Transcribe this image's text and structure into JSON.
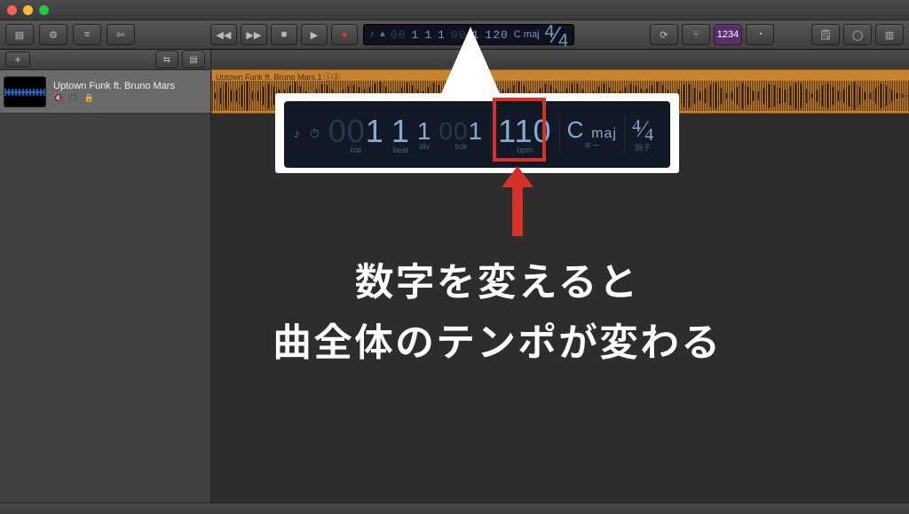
{
  "lcd_small": {
    "bar_dim": "00",
    "bar": "1",
    "beat": "1",
    "div": "1",
    "tick_dim": "00",
    "tick": "1",
    "tempo": "120",
    "key": "C maj",
    "timesig_num": "4",
    "timesig_den": "4"
  },
  "track": {
    "name": "Uptown Funk ft. Bruno Mars",
    "region_title": "Uptown Funk ft. Bruno Mars.1  ⓘ②"
  },
  "lcd_big": {
    "bar_dim": "00",
    "bar": "1",
    "beat": "1",
    "div": "1",
    "tick_dim": "00",
    "tick": "1",
    "tempo": "110",
    "key": "C",
    "key_mode": "maj",
    "timesig_num": "4",
    "timesig_den": "4",
    "label_bar": "bar",
    "label_beat": "beat",
    "label_div": "div",
    "label_tick": "tick",
    "label_bpm": "bpm",
    "label_key": "キー",
    "label_sig": "拍子"
  },
  "annotation": {
    "line1": "数字を変えると",
    "line2": "曲全体のテンポが変わる"
  },
  "toolbar_right": {
    "badge": "1234"
  }
}
